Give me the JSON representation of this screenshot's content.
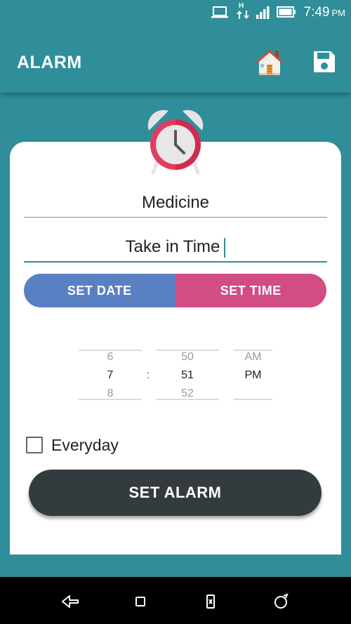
{
  "status_bar": {
    "time": "7:49",
    "ampm": "PM",
    "network_type": "H",
    "icons": [
      "laptop-icon",
      "data-arrows-icon",
      "signal-icon",
      "battery-icon"
    ]
  },
  "app_bar": {
    "title": "ALARM",
    "actions": [
      "house-icon",
      "save-icon"
    ]
  },
  "form": {
    "title_value": "Medicine",
    "note_value": "Take in Time",
    "set_date_label": "SET DATE",
    "set_time_label": "SET TIME",
    "everyday_label": "Everyday",
    "everyday_checked": false,
    "set_alarm_label": "SET ALARM"
  },
  "time_picker": {
    "hour": {
      "prev": "6",
      "selected": "7",
      "next": "8"
    },
    "separator": ":",
    "minute": {
      "prev": "50",
      "selected": "51",
      "next": "52"
    },
    "ampm": {
      "prev": "AM",
      "selected": "PM"
    }
  },
  "nav_bar": {
    "buttons": [
      "back-icon",
      "home-square-icon",
      "recents-icon",
      "assist-icon"
    ]
  },
  "colors": {
    "primary": "#2f8e99",
    "set_date": "#5a80c4",
    "set_time": "#d14d83",
    "set_alarm": "#333b3e",
    "clock_rim": "#e33d5e"
  }
}
